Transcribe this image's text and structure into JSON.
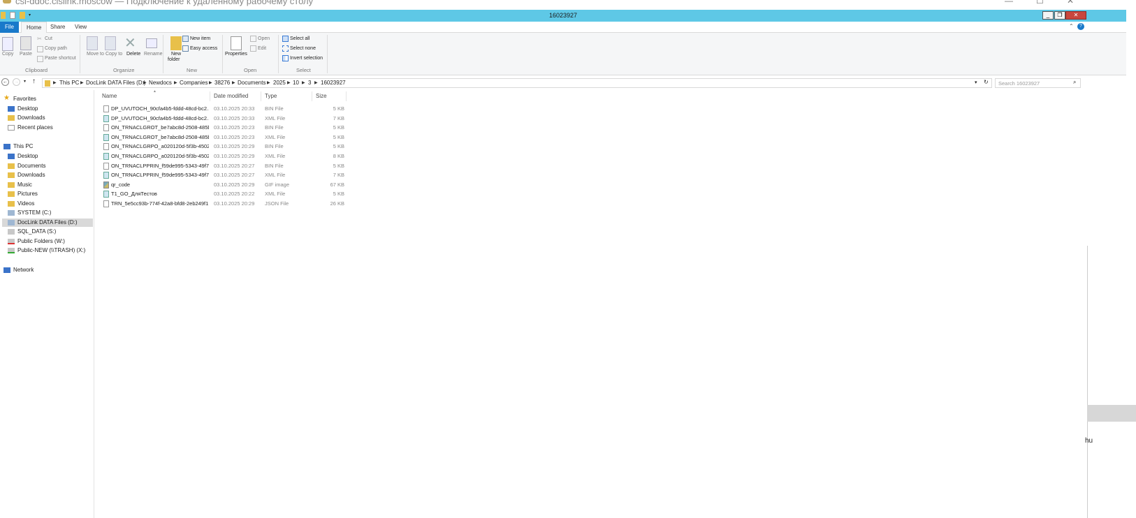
{
  "rdp": {
    "title": "csi-ddoc.cislink.moscow — Подключение к удаленному рабочему столу"
  },
  "explorer": {
    "title": "16023927",
    "tabs": [
      "File",
      "Home",
      "Share",
      "View"
    ],
    "active_tab": "Home"
  },
  "ribbon": {
    "clipboard": {
      "copy": "Copy",
      "paste": "Paste",
      "cut": "Cut",
      "copy_path": "Copy path",
      "paste_shortcut": "Paste shortcut",
      "label": "Clipboard"
    },
    "organize": {
      "move_to": "Move to",
      "copy_to": "Copy to",
      "delete": "Delete",
      "rename": "Rename",
      "label": "Organize"
    },
    "new": {
      "new_folder_1": "New",
      "new_folder_2": "folder",
      "new_item": "New item",
      "easy_access": "Easy access",
      "label": "New"
    },
    "open": {
      "properties": "Properties",
      "open": "Open",
      "edit": "Edit",
      "label": "Open"
    },
    "select": {
      "select_all": "Select all",
      "select_none": "Select none",
      "invert": "Invert selection",
      "label": "Select"
    }
  },
  "address": {
    "crumbs": [
      "This PC",
      "DocLink DATA Files (D:)",
      "Newdocs",
      "Companies",
      "38276",
      "Documents",
      "2025",
      "10",
      "3",
      "16023927"
    ],
    "search_placeholder": "Search 16023927"
  },
  "nav": {
    "favorites": "Favorites",
    "fav_items": [
      "Desktop",
      "Downloads",
      "Recent places"
    ],
    "this_pc": "This PC",
    "pc_items": [
      "Desktop",
      "Documents",
      "Downloads",
      "Music",
      "Pictures",
      "Videos",
      "SYSTEM (C:)",
      "DocLink DATA Files (D:)",
      "SQL_DATA (S:)",
      "Public Folders (W:)",
      "Public-NEW (\\\\TRASH) (X:)"
    ],
    "selected": "DocLink DATA Files (D:)",
    "network": "Network"
  },
  "columns": {
    "name": "Name",
    "date": "Date modified",
    "type": "Type",
    "size": "Size"
  },
  "files": [
    {
      "name": "DP_UVUTOCH_90cfa4b5-fddd-48cd-bc2...",
      "date": "03.10.2025 20:33",
      "type": "BIN File",
      "size": "5 KB",
      "kind": "bin"
    },
    {
      "name": "DP_UVUTOCH_90cfa4b5-fddd-48cd-bc2...",
      "date": "03.10.2025 20:33",
      "type": "XML File",
      "size": "7 KB",
      "kind": "xml"
    },
    {
      "name": "ON_TRNACLGROT_be7abc8d-2508-485b...",
      "date": "03.10.2025 20:23",
      "type": "BIN File",
      "size": "5 KB",
      "kind": "bin"
    },
    {
      "name": "ON_TRNACLGROT_be7abc8d-2508-485b...",
      "date": "03.10.2025 20:23",
      "type": "XML File",
      "size": "5 KB",
      "kind": "xml"
    },
    {
      "name": "ON_TRNACLGRPO_a020120d-5f3b-4502-...",
      "date": "03.10.2025 20:29",
      "type": "BIN File",
      "size": "5 KB",
      "kind": "bin"
    },
    {
      "name": "ON_TRNACLGRPO_a020120d-5f3b-4502-...",
      "date": "03.10.2025 20:29",
      "type": "XML File",
      "size": "8 KB",
      "kind": "xml"
    },
    {
      "name": "ON_TRNACLPPRIN_f59de995-5343-49f7-...",
      "date": "03.10.2025 20:27",
      "type": "BIN File",
      "size": "5 KB",
      "kind": "bin"
    },
    {
      "name": "ON_TRNACLPPRIN_f59de995-5343-49f7-...",
      "date": "03.10.2025 20:27",
      "type": "XML File",
      "size": "7 KB",
      "kind": "xml"
    },
    {
      "name": "qr_code",
      "date": "03.10.2025 20:29",
      "type": "GIF image",
      "size": "67 KB",
      "kind": "gif"
    },
    {
      "name": "T1_GO_ДляТестов",
      "date": "03.10.2025 20:22",
      "type": "XML File",
      "size": "5 KB",
      "kind": "xml"
    },
    {
      "name": "TRN_5e5cc93b-774f-42a8-bfd8-2eb249f1...",
      "date": "03.10.2025 20:29",
      "type": "JSON File",
      "size": "26 KB",
      "kind": "json"
    }
  ],
  "edge_text": "hu",
  "colors": {
    "title_bar": "#5ec8e6",
    "file_tab": "#1979ca",
    "close": "#c9463d"
  }
}
